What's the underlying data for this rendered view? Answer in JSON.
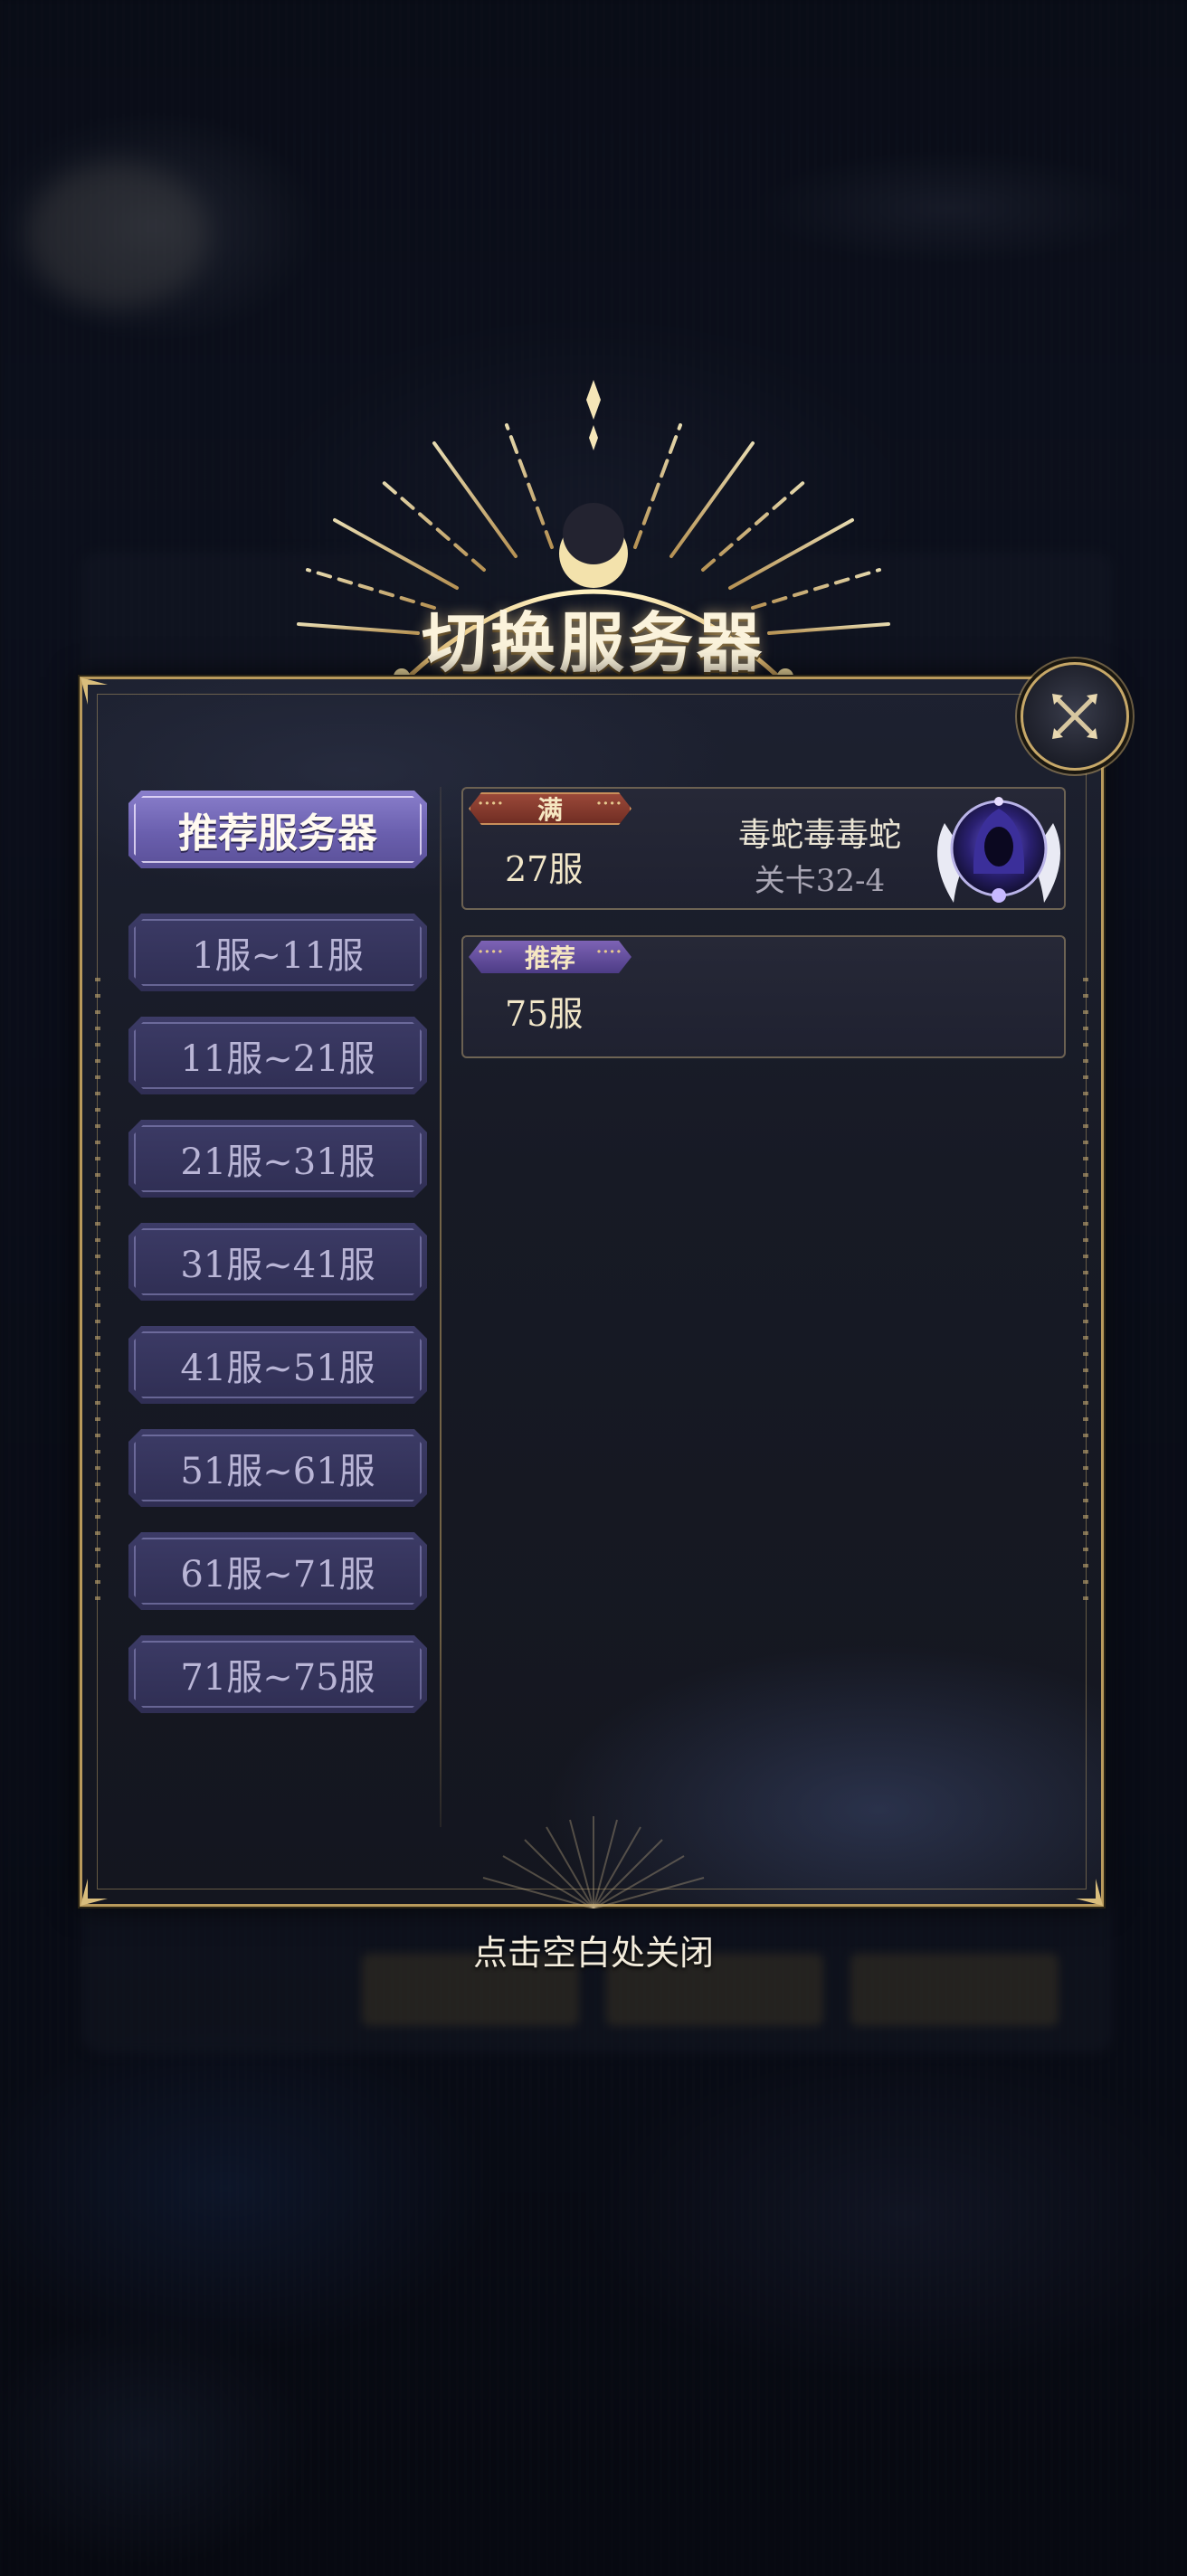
{
  "dialog": {
    "title": "切换服务器",
    "close_hint": "点击空白处关闭"
  },
  "tabs": [
    {
      "label": "推荐服务器",
      "active": true
    },
    {
      "label": "1服~11服",
      "active": false
    },
    {
      "label": "11服~21服",
      "active": false
    },
    {
      "label": "21服~31服",
      "active": false
    },
    {
      "label": "31服~41服",
      "active": false
    },
    {
      "label": "41服~51服",
      "active": false
    },
    {
      "label": "51服~61服",
      "active": false
    },
    {
      "label": "61服~71服",
      "active": false
    },
    {
      "label": "71服~75服",
      "active": false
    }
  ],
  "servers": [
    {
      "badge": "满",
      "server": "27服",
      "player": "毒蛇毒毒蛇",
      "stage": "关卡32-4",
      "has_avatar": true
    },
    {
      "badge": "推荐",
      "server": "75服"
    }
  ],
  "colors": {
    "gold_border": "#b99a5c",
    "tab_active": "#7a6fbe",
    "tab_inactive": "#35345c",
    "badge_full": "#8a3a2e",
    "badge_recommend": "#6a54a6"
  },
  "icons": {
    "close": "close-x-icon",
    "avatar": "winged-hooded-avatar-icon",
    "crown": "crescent-sunburst-icon"
  }
}
